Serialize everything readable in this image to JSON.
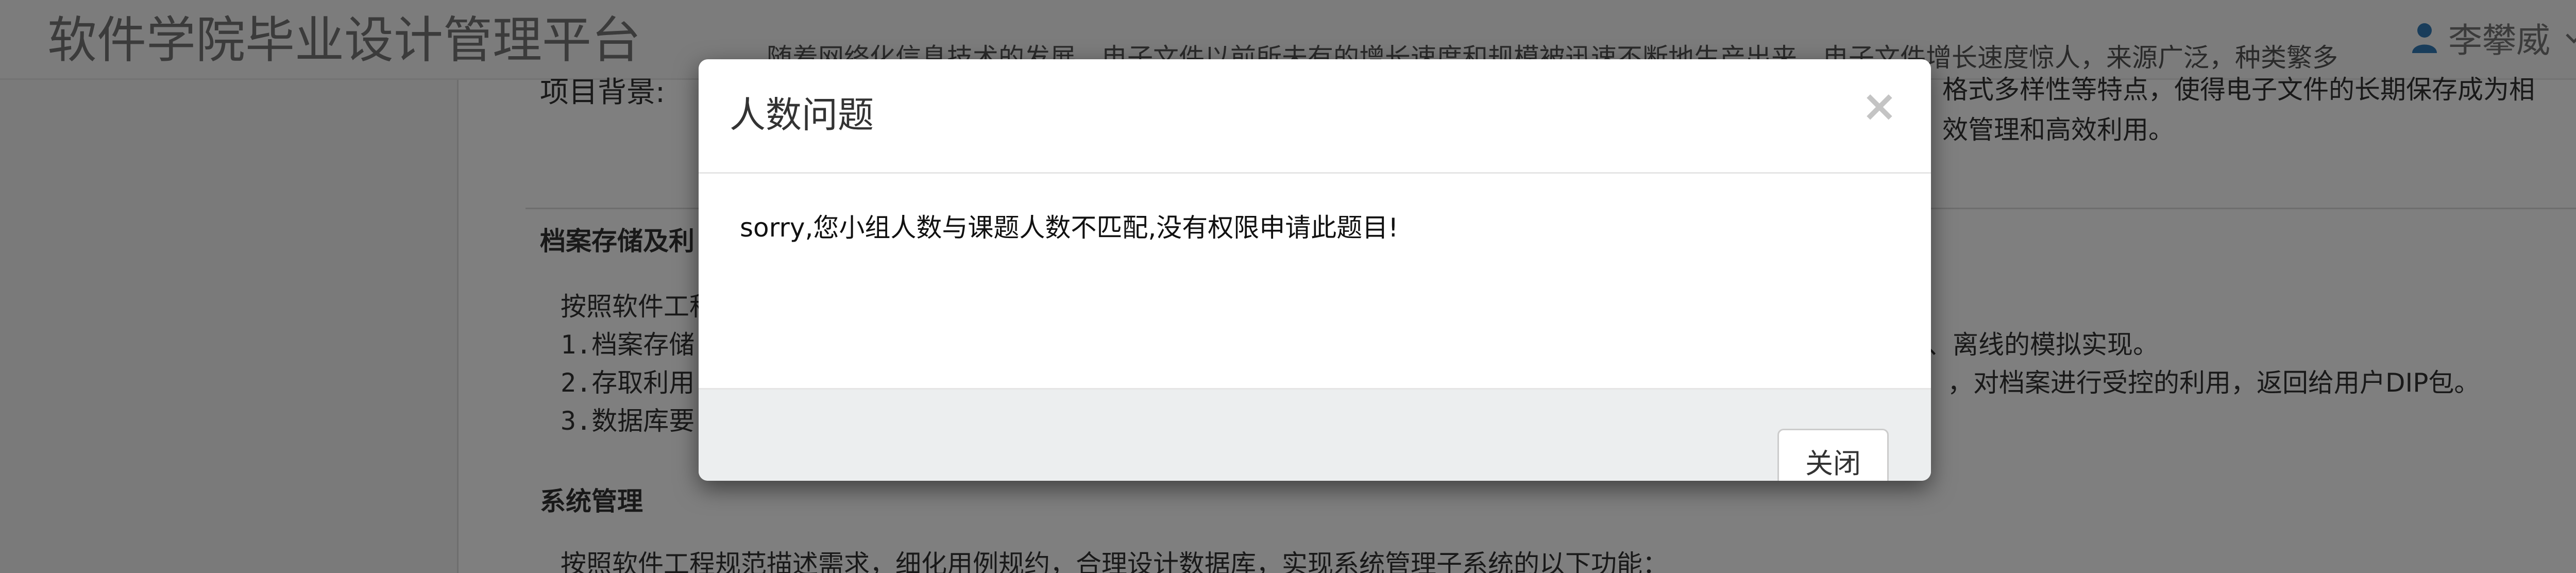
{
  "navbar": {
    "brand": "软件学院毕业设计管理平台",
    "user_name": "李攀威",
    "user_icon": "user-icon",
    "dropdown_icon": "chevron-down-icon"
  },
  "content": {
    "overflow_text": "随着网络化信息技术的发展，电子文件以前所未有的增长速度和规模被迅速不断地生产出来，电子文件增长速度惊人，来源广泛，种类繁多",
    "project_background_label": "项目背景:",
    "background_line1_tail": "格式多样性等特点，使得电子文件的长期保存成为相",
    "background_line2_tail": "效管理和高效利用。",
    "section1_heading": "档案存储及利",
    "section1_intro": "按照软件工程",
    "section1_item1": "1.档案存储",
    "section1_item1_tail": "、离线的模拟实现。",
    "section1_item2": "2.存取利用",
    "section1_item2_tail": "，对档案进行受控的利用，返回给用户DIP包。",
    "section1_item3": "3.数据库要",
    "section2_heading": "系统管理",
    "section2_intro": "按照软件工程规范描述需求，细化用例规约，合理设计数据库，实现系统管理子系统的以下功能："
  },
  "modal": {
    "title": "人数问题",
    "close_symbol": "×",
    "message": "sorry,您小组人数与课题人数不匹配,没有权限申请此题目!",
    "footer_button": "关闭"
  },
  "colors": {
    "brand_text": "#777777",
    "user_icon": "#337ab7",
    "backdrop": "rgba(0,0,0,0.5)",
    "modal_footer_bg": "#eceeef"
  }
}
